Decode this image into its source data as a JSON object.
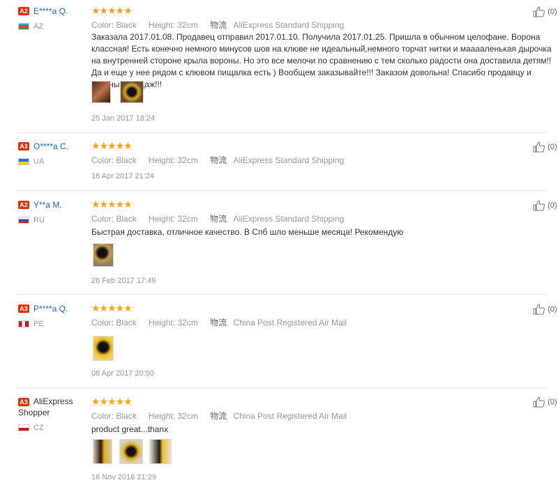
{
  "reviews": [
    {
      "badge": "A2",
      "user": "E****a Q.",
      "country": "AZ",
      "stars": "★★★★★",
      "color": "Color: Black",
      "height": "Height: 32cm",
      "ship_label": "物流",
      "shipping": "AliExpress Standard Shipping",
      "text": "Заказала 2017.01.08. Продавец отправил 2017.01.10. Получила 2017.01.25. Пришла в обычном целофане. Ворона классная! Есть конечно немного минусов шов на клюве не идеальный,немного торчат нитки и мааааленькая дырочка на внутренней стороне крыла вороны. Но это все мелочи по сравнению с тем сколько радости она доставила детям!! Да и еще у нее рядом с клювом пищалка есть ) Вообщем заказывайте!!! Заказом довольна! Спасибо продавцу и удачных продаж!!!",
      "date": "25 Jan 2017 18:24",
      "likes": "(0)"
    },
    {
      "badge": "A3",
      "user": "O****a C.",
      "country": "UA",
      "stars": "★★★★★",
      "color": "Color: Black",
      "height": "Height: 32cm",
      "ship_label": "物流",
      "shipping": "AliExpress Standard Shipping",
      "date": "16 Apr 2017 21:24",
      "likes": "(0)"
    },
    {
      "badge": "A2",
      "user": "Y**a M.",
      "country": "RU",
      "stars": "★★★★★",
      "color": "Color: Black",
      "height": "Height: 32cm",
      "ship_label": "物流",
      "shipping": "AliExpress Standard Shipping",
      "text": "Быстрая доставка, отличное качество. В Спб шло меньше месяца! Рекомендую",
      "date": "26 Feb 2017 17:49",
      "likes": "(0)"
    },
    {
      "badge": "A3",
      "user": "P****a Q.",
      "country": "PE",
      "stars": "★★★★★",
      "color": "Color: Black",
      "height": "Height: 32cm",
      "ship_label": "物流",
      "shipping": "China Post Registered Air Mail",
      "date": "08 Apr 2017 20:50",
      "likes": "(0)"
    },
    {
      "badge": "A3",
      "user": "AliExpress Shopper",
      "country": "CZ",
      "stars": "★★★★★",
      "color": "Color: Black",
      "height": "Height: 32cm",
      "ship_label": "物流",
      "shipping": "China Post Registered Air Mail",
      "text": "product great...thanx",
      "date": "16 Nov 2016 21:29",
      "likes": "(0)"
    }
  ],
  "colors": {
    "badge": "#e62e04",
    "star": "#f7a21b",
    "username": "#1a6bc6"
  }
}
